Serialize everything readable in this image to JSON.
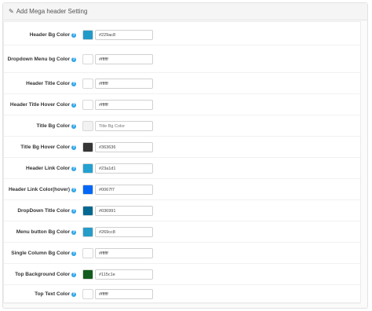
{
  "panel": {
    "title": "Add Mega header Setting"
  },
  "rows": [
    {
      "label": "Header Bg Color",
      "value": "#229ac8",
      "placeholder": "",
      "swatch": "#229ac8"
    },
    {
      "label": "Dropdown Menu bg Color",
      "value": "#ffffff",
      "placeholder": "",
      "swatch": "#ffffff"
    },
    {
      "label": "Header Title Color",
      "value": "#ffffff",
      "placeholder": "",
      "swatch": "#ffffff"
    },
    {
      "label": "Header Title Hover Color",
      "value": "#ffffff",
      "placeholder": "",
      "swatch": "#ffffff"
    },
    {
      "label": "Title Bg Color",
      "value": "",
      "placeholder": "Title Bg Color",
      "swatch": "#f2f2f2"
    },
    {
      "label": "Title Bg Hover Color",
      "value": "#363636",
      "placeholder": "",
      "swatch": "#363636"
    },
    {
      "label": "Header Link Color",
      "value": "#23a1d1",
      "placeholder": "",
      "swatch": "#23a1d1"
    },
    {
      "label": "Header Link Color(hover)",
      "value": "#0067f7",
      "placeholder": "",
      "swatch": "#0067f7"
    },
    {
      "label": "DropDown Title Color",
      "value": "#036991",
      "placeholder": "",
      "swatch": "#036991"
    },
    {
      "label": "Menu button Bg Color",
      "value": "#269cc8",
      "placeholder": "",
      "swatch": "#269cc8"
    },
    {
      "label": "Single Column Bg Color",
      "value": "#ffffff",
      "placeholder": "",
      "swatch": "#ffffff"
    },
    {
      "label": "Top Background Color",
      "value": "#115c1e",
      "placeholder": "",
      "swatch": "#115c1e"
    },
    {
      "label": "Top Text Color",
      "value": "#ffffff",
      "placeholder": "",
      "swatch": "#ffffff"
    }
  ]
}
